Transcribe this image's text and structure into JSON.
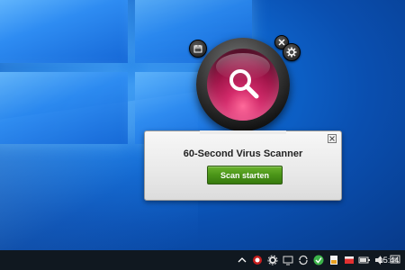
{
  "gadget": {
    "scan_orb_icon": "magnifier-icon",
    "calendar_icon": "calendar-icon",
    "close_icon": "close-icon",
    "settings_icon": "gear-icon",
    "accent_color": "#c21e5a"
  },
  "panel": {
    "title": "60-Second Virus Scanner",
    "scan_button_label": "Scan starten",
    "scan_button_color": "#4a9418",
    "close_icon": "close-icon"
  },
  "taskbar": {
    "background": "#101820",
    "tray_icons": [
      "chevron-up-icon",
      "security-shield-icon",
      "settings-icon",
      "network-monitor-icon",
      "sync-icon",
      "green-app-icon",
      "document-icon",
      "flag-icon",
      "battery-icon",
      "volume-icon",
      "action-center-icon"
    ],
    "clock": "15:44"
  }
}
